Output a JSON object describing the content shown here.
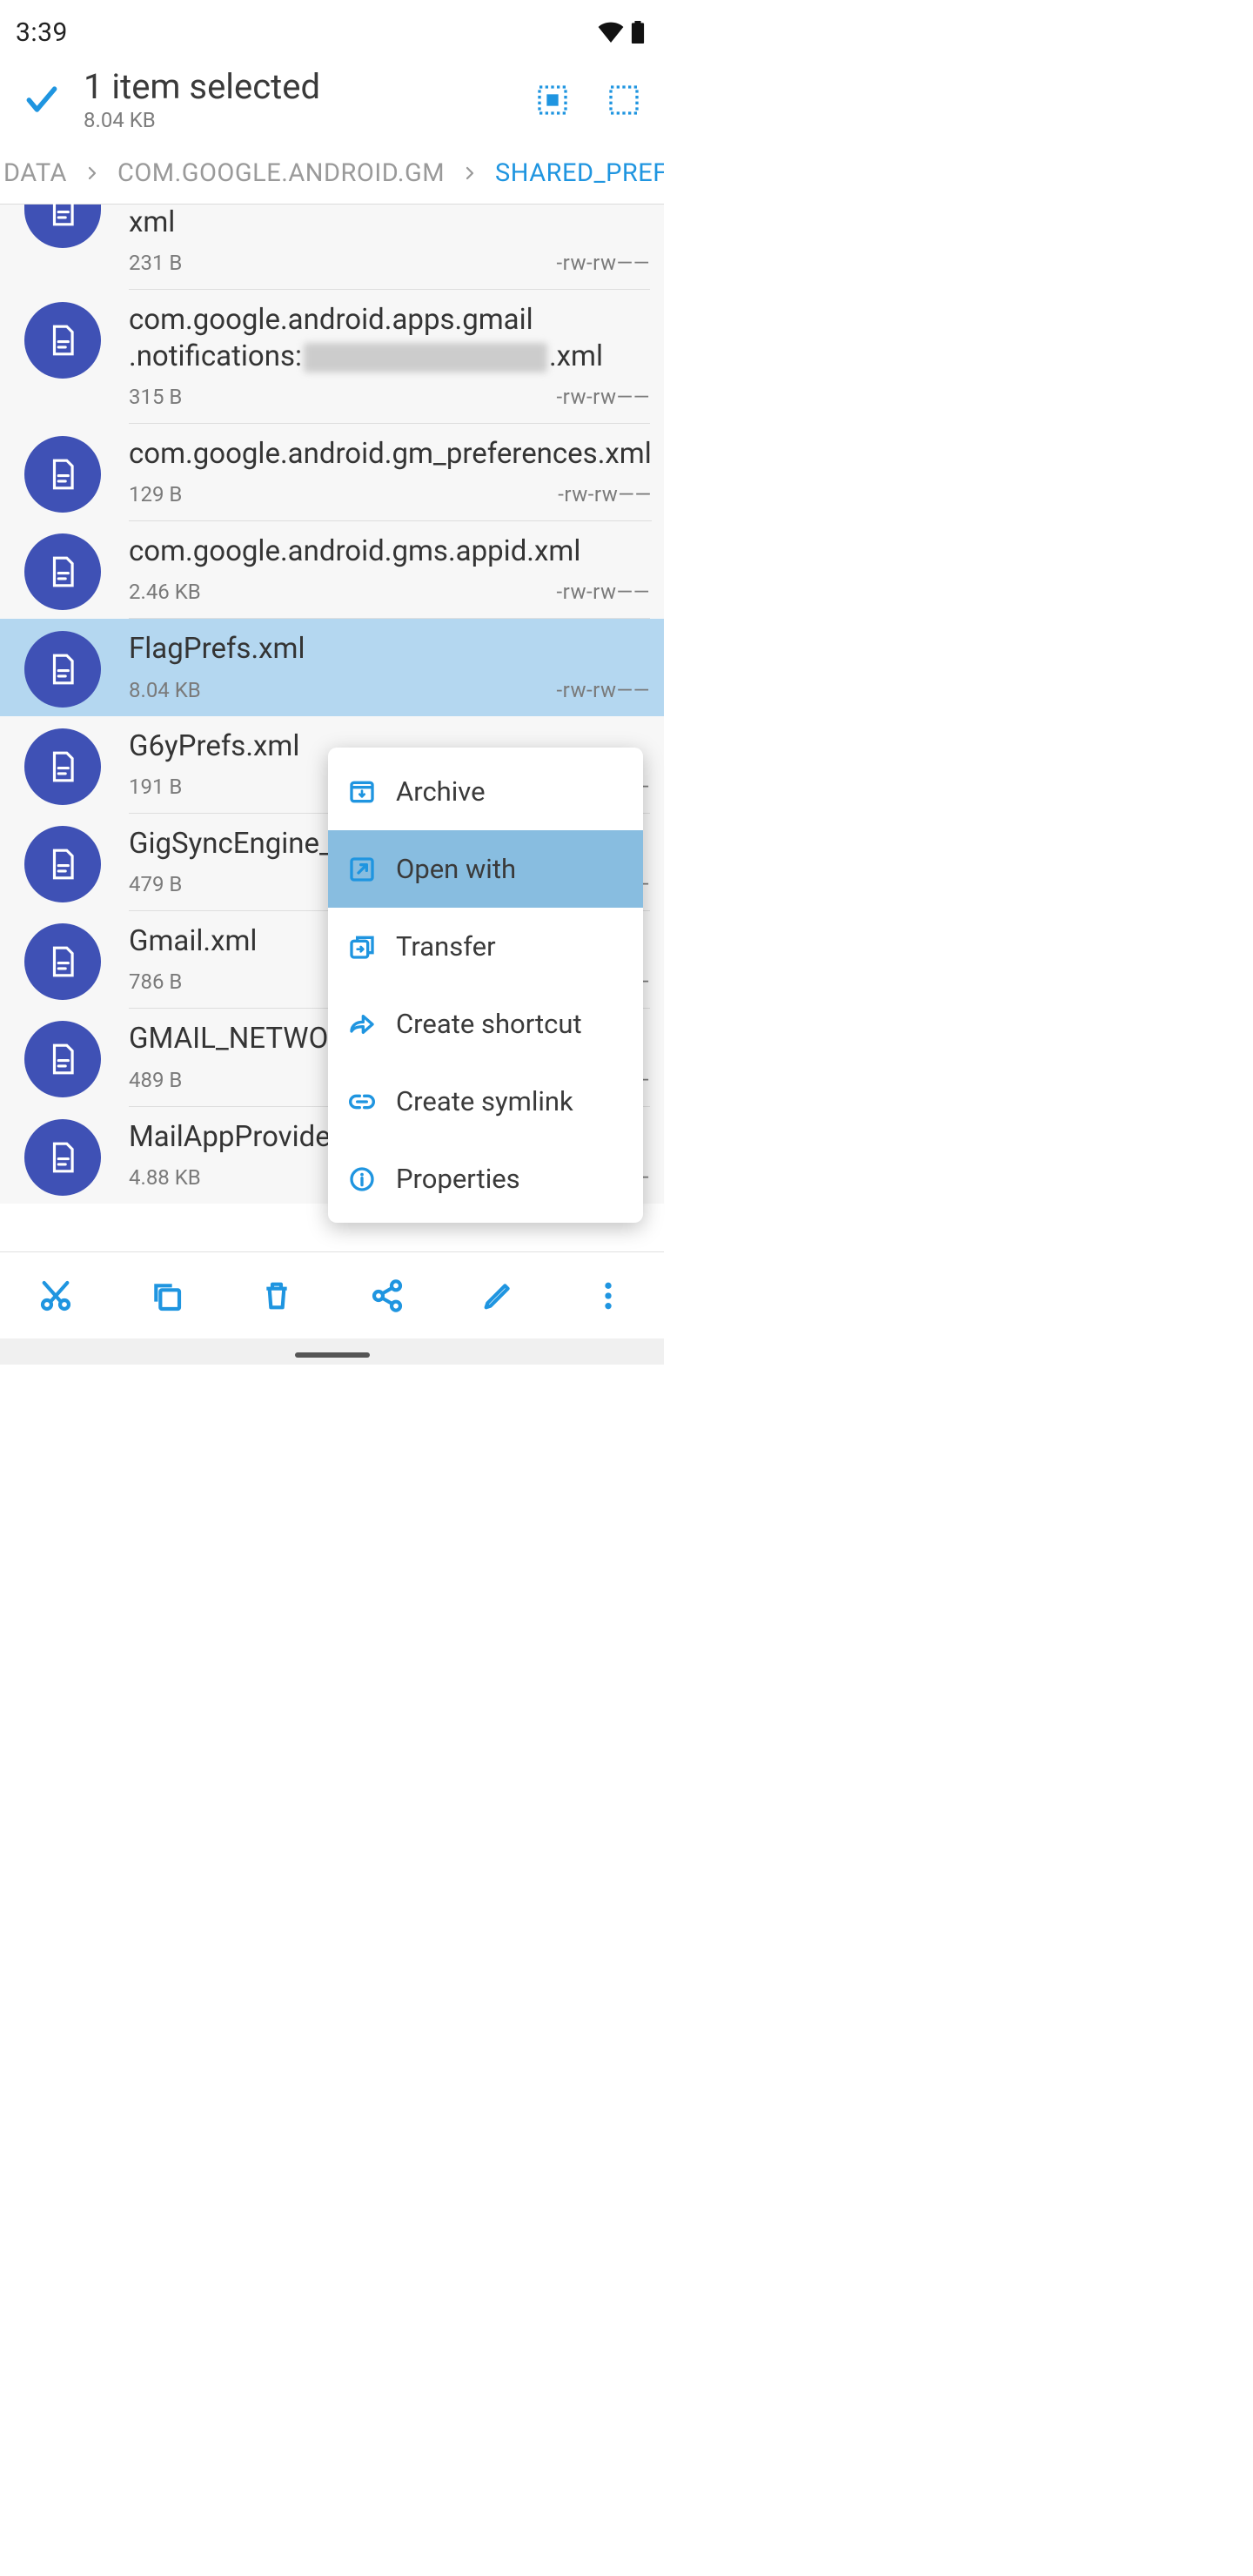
{
  "status": {
    "time": "3:39"
  },
  "appbar": {
    "title": "1 item selected",
    "subtitle": "8.04 KB"
  },
  "breadcrumb": {
    "b0": "DATA",
    "b1": "COM.GOOGLE.ANDROID.GM",
    "b2": "SHARED_PREFS"
  },
  "files": [
    {
      "name": "xml",
      "size": "231 B",
      "perm": "-rw-rw——"
    },
    {
      "name_pre": "com.google.android.apps.gmail\n.notifications:",
      "name_post": ".xml",
      "size": "315 B",
      "perm": "-rw-rw——",
      "redacted": true
    },
    {
      "name": "com.google.android.gm_preferences.xml",
      "size": "129 B",
      "perm": "-rw-rw——"
    },
    {
      "name": "com.google.android.gms.appid.xml",
      "size": "2.46 KB",
      "perm": "-rw-rw——"
    },
    {
      "name": "FlagPrefs.xml",
      "size": "8.04 KB",
      "perm": "-rw-rw——",
      "selected": true
    },
    {
      "name": "G6yPrefs.xml",
      "size": "191 B",
      "perm": "-rw-rw——"
    },
    {
      "name": "GigSyncEngine_h",
      "size": "479 B",
      "perm": "-rw-rw——"
    },
    {
      "name": "Gmail.xml",
      "size": "786 B",
      "perm": "-rw-rw——"
    },
    {
      "name": "GMAIL_NETWOR",
      "size": "489 B",
      "perm": "-rw-rw——"
    },
    {
      "name": "MailAppProvider.x",
      "size": "4.88 KB",
      "perm": "-rw-rw——"
    }
  ],
  "menu": {
    "archive": "Archive",
    "openwith": "Open with",
    "transfer": "Transfer",
    "shortcut": "Create shortcut",
    "symlink": "Create symlink",
    "properties": "Properties"
  }
}
